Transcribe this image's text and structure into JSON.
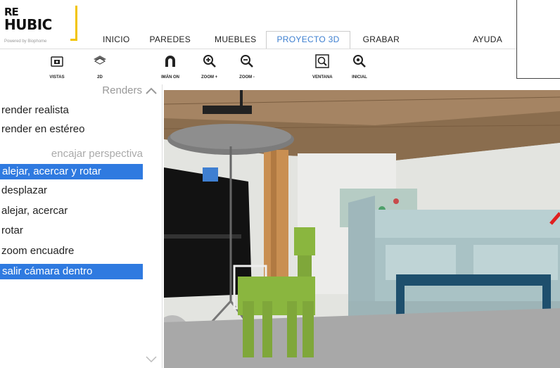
{
  "logo": {
    "line1": "RE",
    "line2": "HUBIC",
    "sub": "Powered by Biophome"
  },
  "tabs": [
    {
      "label": "INICIO"
    },
    {
      "label": "PAREDES"
    },
    {
      "label": "MUEBLES"
    },
    {
      "label": "PROYECTO 3D",
      "active": true
    },
    {
      "label": "GRABAR"
    },
    {
      "label": "AYUDA"
    }
  ],
  "toolbar": {
    "vistas": "VISTAS",
    "d2": "2D",
    "iman": "IMÁN ON",
    "zoom_in": "ZOOM +",
    "zoom_out": "ZOOM -",
    "ventana": "VENTANA",
    "inicial": "INICIAL"
  },
  "left": {
    "header": "Renders",
    "items1": [
      "render realista",
      "render en estéreo"
    ],
    "section2": "encajar perspectiva",
    "items2": [
      "alejar, acercar y rotar",
      "desplazar",
      "alejar, acercar",
      "rotar",
      "zoom encuadre",
      "salir cámara dentro"
    ]
  },
  "colors": {
    "accent": "#3d7fd0",
    "selected_bg": "#2f7ae0",
    "logo_yellow": "#f2c400"
  }
}
